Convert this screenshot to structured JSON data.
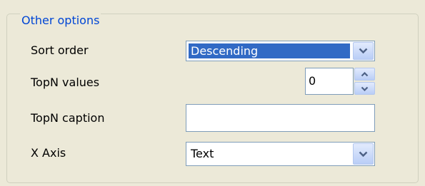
{
  "group": {
    "title": "Other options"
  },
  "fields": {
    "sort_order": {
      "label": "Sort order",
      "value": "Descending"
    },
    "topn_values": {
      "label": "TopN values",
      "value": "0"
    },
    "topn_caption": {
      "label": "TopN caption",
      "value": ""
    },
    "x_axis": {
      "label": "X Axis",
      "value": "Text"
    }
  },
  "icons": {
    "dropdown": "chevron-down-icon",
    "spin_up": "chevron-up-icon",
    "spin_down": "chevron-down-icon"
  },
  "colors": {
    "group_title": "#0046d5",
    "selection": "#316ac5",
    "field_border": "#7f9db9",
    "arrow_glyph": "#4d6185"
  }
}
